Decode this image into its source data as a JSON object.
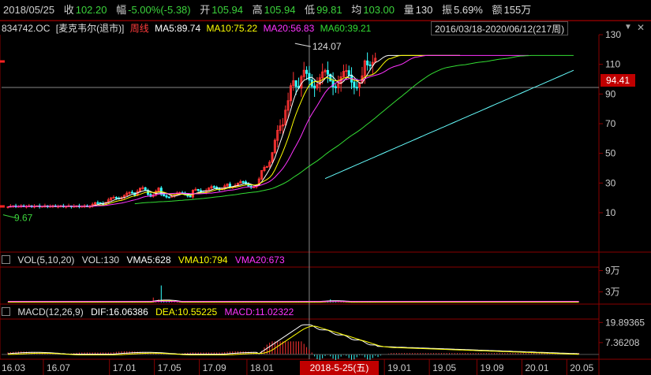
{
  "topbar": {
    "date": "2018/05/25",
    "close_label": "收",
    "close_value": "102.20",
    "change_label": "幅",
    "change_value": "-5.00%(-5.38)",
    "open_label": "开",
    "open_value": "105.94",
    "high_label": "高",
    "high_value": "105.94",
    "low_label": "低",
    "low_value": "99.81",
    "avg_label": "均",
    "avg_value": "103.00",
    "volume_label": "量",
    "volume_value": "130",
    "amplitude_label": "振",
    "amplitude_value": "5.69%",
    "amount_label": "额",
    "amount_value": "155万"
  },
  "main_header": {
    "code": "834742.OC",
    "name": "[麦克韦尔(退市)]",
    "period": "周线",
    "ma5": "MA5:89.74",
    "ma10": "MA10:75.22",
    "ma20": "MA20:56.83",
    "ma60": "MA60:39.21",
    "range": "2016/03/18-2020/06/12(217周)",
    "dropdown_icon": "triangle-down-icon",
    "close_icon": "close-x-icon"
  },
  "main_chart": {
    "y_ticks": [
      "130",
      "110",
      "90",
      "70",
      "50",
      "30",
      "10"
    ],
    "current_price": "94.41",
    "max_annotation": "124.07",
    "min_annotation": "9.67"
  },
  "vol_header": {
    "name": "VOL(5,10,20)",
    "vol": "VOL:130",
    "vma5": "VMA5:628",
    "vma10": "VMA10:794",
    "vma20": "VMA20:673",
    "y_ticks": [
      "9万",
      "3万"
    ]
  },
  "macd_header": {
    "name": "MACD(12,26,9)",
    "dif": "DIF:16.06386",
    "dea": "DEA:10.55225",
    "macd": "MACD:11.02322",
    "y_ticks": [
      "19.89365",
      "7.36208"
    ]
  },
  "x_axis": {
    "labels": [
      "16.03",
      "16.07",
      "17.01",
      "17.05",
      "17.09",
      "18.01",
      "19.01",
      "19.05",
      "19.09",
      "20.01",
      "20.05"
    ],
    "cursor_date": "2018-5-25(五)"
  },
  "colors": {
    "ma5": "#ffffff",
    "ma10": "#ffff00",
    "ma20": "#ff33ff",
    "ma60": "#33dd33",
    "line_cyan": "#66ffff",
    "up": "#ff3333",
    "down": "#33ffff",
    "axis_red": "#8a0000"
  }
}
